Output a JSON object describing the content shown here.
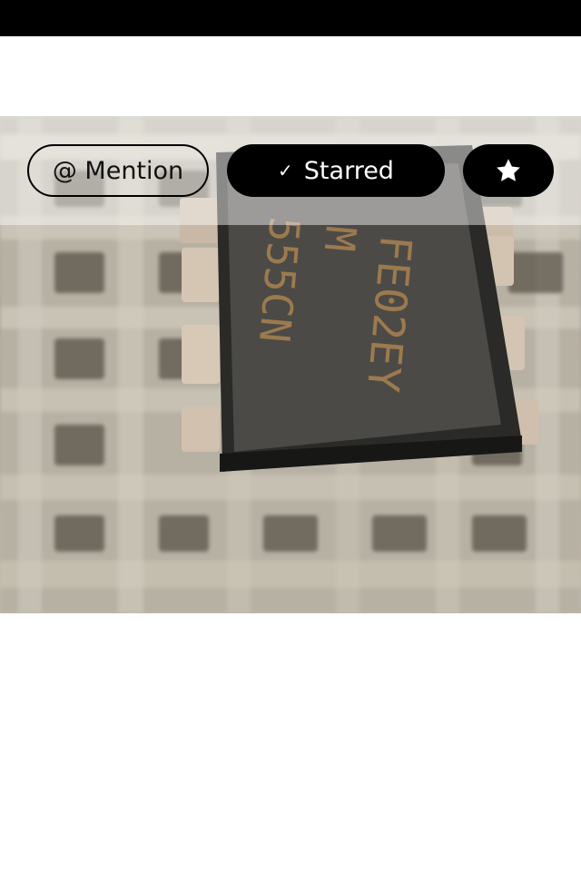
{
  "status_bar": {},
  "photo": {
    "chip_marking_lines": [
      "FE02EY",
      "M",
      "555CN"
    ]
  },
  "toolbar": {
    "mention_label": "@ Mention",
    "starred_check": "✓",
    "starred_label": "Starred",
    "star_icon": "star-icon"
  },
  "colors": {
    "pill_active_bg": "#000000",
    "pill_active_text": "#ffffff",
    "pill_outline": "#000000"
  }
}
